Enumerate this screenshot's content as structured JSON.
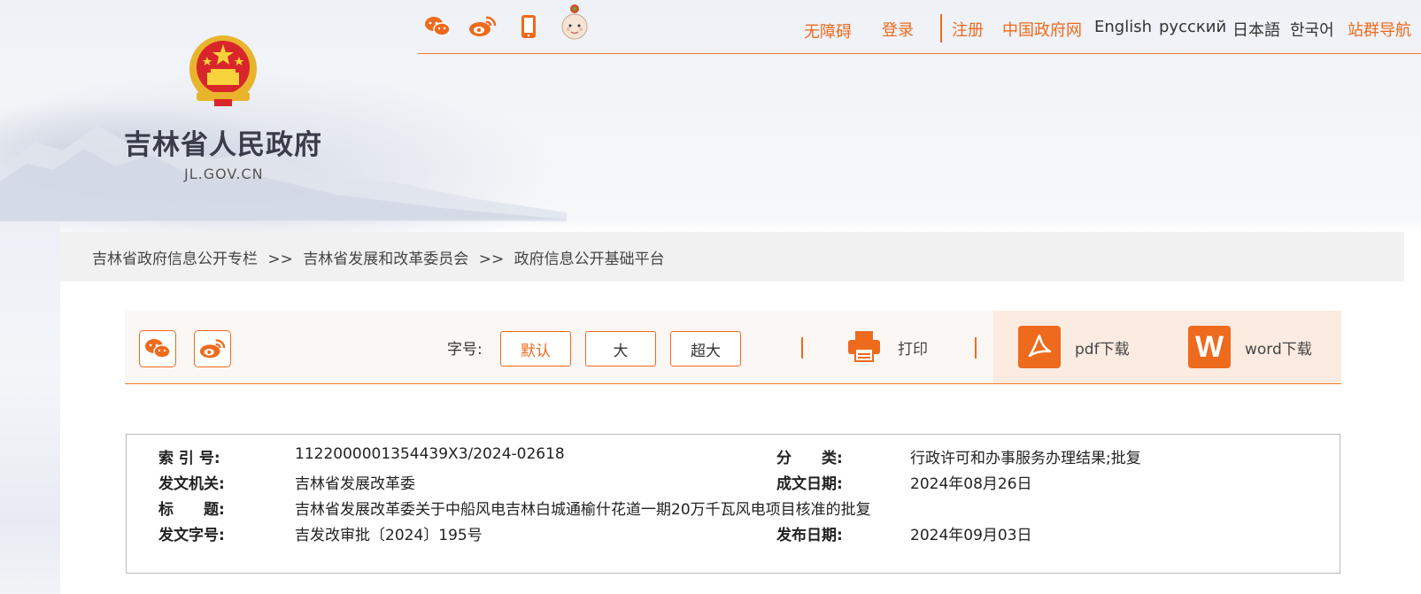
{
  "header": {
    "site_title": "吉林省人民政府",
    "site_domain": "JL.GOV.CN",
    "nav": {
      "accessibility": "无障碍",
      "login": "登录",
      "register": "注册",
      "gov_portal": "中国政府网",
      "english": "English",
      "russian": "русский",
      "japanese": "日本語",
      "korean": "한국어",
      "sitemap": "站群导航"
    },
    "icons": [
      "wechat-icon",
      "weibo-icon",
      "mobile-icon",
      "mascot-icon"
    ]
  },
  "breadcrumb": {
    "items": [
      "吉林省政府信息公开专栏",
      "吉林省发展和改革委员会",
      "政府信息公开基础平台"
    ],
    "separator": ">>"
  },
  "toolbar": {
    "font_size_label": "字号:",
    "font_sizes": [
      "默认",
      "大",
      "超大"
    ],
    "selected_font_size": "默认",
    "print_label": "打印",
    "pdf_label": "pdf下载",
    "word_label": "word下载",
    "accent": "#ee6a1c"
  },
  "meta": {
    "index_no_label": "索 引 号:",
    "index_no": "1122000001354439X3/2024-02618",
    "category_label": "分　　类:",
    "category": "行政许可和办事服务办理结果;批复",
    "issuer_label": "发文机关:",
    "issuer": "吉林省发展改革委",
    "created_date_label": "成文日期:",
    "created_date": "2024年08月26日",
    "title_label": "标　　题:",
    "title": "吉林省发展改革委关于中船风电吉林白城通榆什花道一期20万千瓦风电项目核准的批复",
    "doc_no_label": "发文字号:",
    "doc_no": "吉发改审批〔2024〕195号",
    "publish_date_label": "发布日期:",
    "publish_date": "2024年09月03日"
  }
}
